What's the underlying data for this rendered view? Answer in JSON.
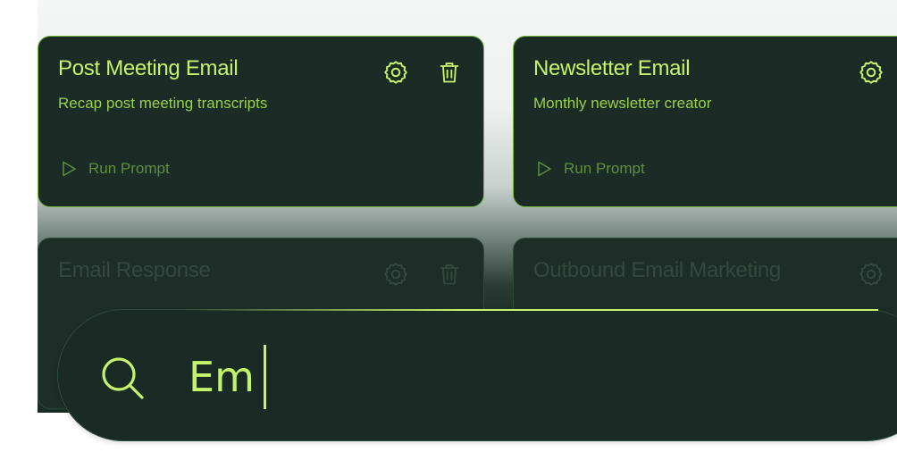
{
  "cards": [
    {
      "title": "Post Meeting Email",
      "subtitle": "Recap post meeting transcripts",
      "run_label": "Run Prompt",
      "icons": [
        "gear-icon",
        "trash-icon"
      ]
    },
    {
      "title": "Newsletter Email",
      "subtitle": "Monthly newsletter creator",
      "run_label": "Run Prompt",
      "icons": [
        "gear-icon"
      ]
    },
    {
      "title": "Email Response",
      "icons": [
        "gear-icon",
        "trash-icon"
      ]
    },
    {
      "title": "Outbound Email Marketing",
      "icons": [
        "gear-icon"
      ]
    }
  ],
  "search": {
    "value": "Em",
    "icon": "search-icon"
  },
  "colors": {
    "accent": "#c7f36b",
    "accent_muted": "#98cf50",
    "card_bg": "#1b2c26",
    "card_border": "#74b83a",
    "run_prompt": "#5f8f3c"
  }
}
